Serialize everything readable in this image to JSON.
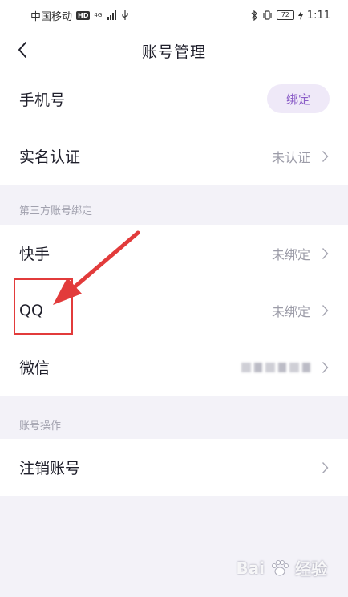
{
  "status_bar": {
    "carrier": "中国移动",
    "hd": "HD",
    "network": "4G",
    "battery": "72",
    "time": "1:11"
  },
  "nav": {
    "title": "账号管理"
  },
  "account_rows": [
    {
      "label": "手机号",
      "action": "绑定"
    },
    {
      "label": "实名认证",
      "value": "未认证"
    }
  ],
  "third_party": {
    "header": "第三方账号绑定",
    "rows": [
      {
        "label": "快手",
        "value": "未绑定"
      },
      {
        "label": "QQ",
        "value": "未绑定"
      },
      {
        "label": "微信"
      }
    ]
  },
  "account_ops": {
    "header": "账号操作",
    "rows": [
      {
        "label": "注销账号"
      }
    ]
  },
  "watermark": {
    "text": "Bai",
    "suffix": "经验"
  },
  "colors": {
    "accent": "#8a5cc7",
    "accent_bg": "#efe9f8",
    "annotation": "#e23b3b",
    "page_bg": "#f3f2f8"
  }
}
